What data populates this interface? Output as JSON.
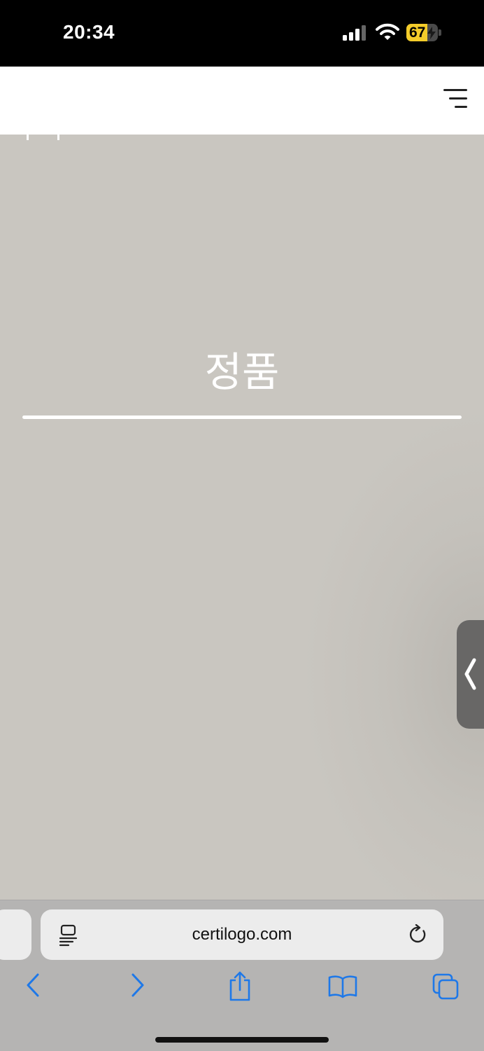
{
  "status_bar": {
    "time": "20:34",
    "battery_level": "67",
    "battery_fraction": 0.67,
    "battery_color": "#f4cc2a",
    "icons": [
      "signal-icon",
      "wifi-icon",
      "battery-icon",
      "bolt-icon"
    ]
  },
  "header": {
    "menu_icon": "menu-icon"
  },
  "hero": {
    "title": "정품",
    "background_color": "#c9c6c0",
    "side_tab_icon": "chevron-left-icon"
  },
  "browser": {
    "url": "certilogo.com",
    "icons": [
      "reader-icon",
      "reload-icon",
      "back-icon",
      "forward-icon",
      "share-icon",
      "bookmarks-icon",
      "tabs-icon"
    ],
    "accent_color": "#1e78e8"
  }
}
